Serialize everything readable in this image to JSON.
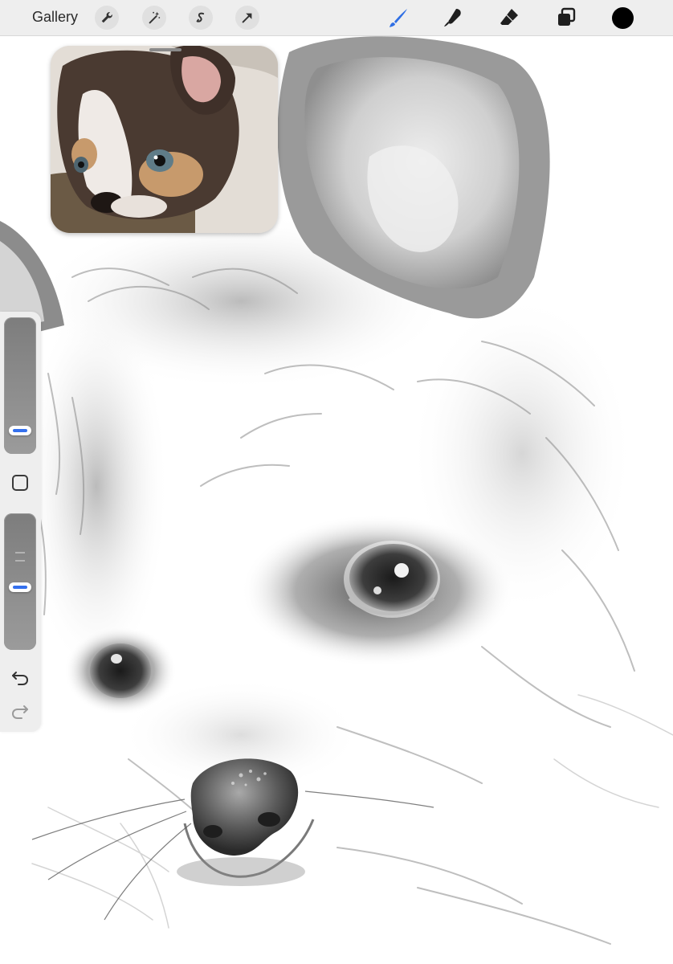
{
  "toolbar": {
    "gallery_label": "Gallery",
    "left_tools": [
      "wrench-icon",
      "magic-wand-icon",
      "selection-icon",
      "transform-arrow-icon"
    ],
    "right_tools": [
      "brush-icon",
      "smudge-icon",
      "eraser-icon",
      "layers-icon"
    ],
    "active_tool": "brush-icon",
    "current_color": "#000000"
  },
  "colors": {
    "accent": "#2f6fe4",
    "toolbar_bg": "#eeeeee"
  },
  "sidebar": {
    "brush_size_fraction": 0.2,
    "opacity_fraction": 0.45,
    "tools": [
      "modify-square-icon",
      "undo-icon",
      "redo-icon"
    ]
  },
  "reference_window": {
    "content": "reference-photo"
  }
}
